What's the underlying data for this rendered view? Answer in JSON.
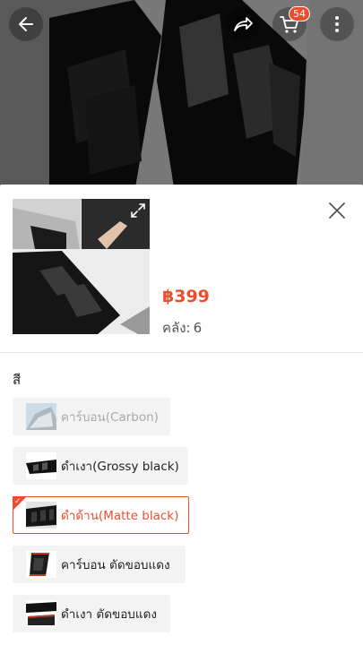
{
  "header": {
    "cart_count": "54",
    "back_icon": "back-arrow-icon",
    "share_icon": "share-icon",
    "cart_icon": "cart-icon",
    "more_icon": "more-vertical-icon"
  },
  "sheet": {
    "price": "฿399",
    "stock_label": "คลัง:",
    "stock_value": "6",
    "section_label": "สี",
    "options": [
      {
        "label": "คาร์บอน(Carbon)",
        "state": "disabled"
      },
      {
        "label": "ดำเงา(Grossy black)",
        "state": "normal"
      },
      {
        "label": "ดำด้าน(Matte black)",
        "state": "selected"
      },
      {
        "label": "คาร์บอน ตัดขอบแดง",
        "state": "normal"
      },
      {
        "label": "ดำเงา ตัดขอบแดง",
        "state": "normal"
      }
    ]
  },
  "colors": {
    "accent": "#ee4d2d",
    "disabled_text": "#a9a9a9",
    "option_bg": "#f3f3f3"
  }
}
